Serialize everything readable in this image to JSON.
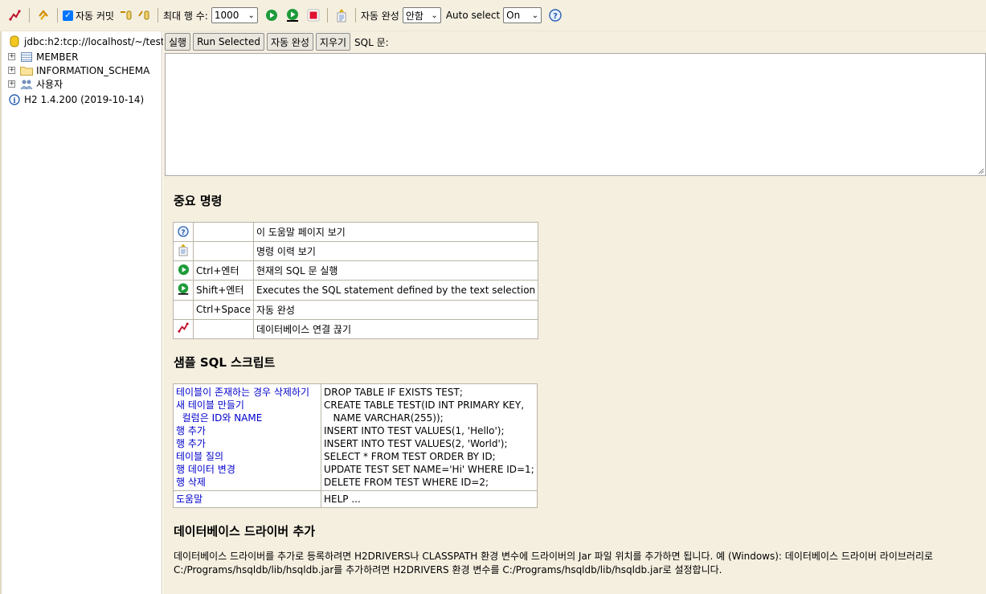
{
  "toolbar": {
    "autocommit_label": "자동 커밋",
    "max_rows_label": "최대 행 수:",
    "max_rows_value": "1000",
    "autocomplete_label": "자동 완성",
    "autocomplete_value": "안함",
    "autoselect_label": "Auto select",
    "autoselect_value": "On"
  },
  "sidebar": {
    "connection": "jdbc:h2:tcp://localhost/~/test",
    "items": [
      {
        "label": "MEMBER",
        "icon": "table-icon"
      },
      {
        "label": "INFORMATION_SCHEMA",
        "icon": "folder-icon"
      },
      {
        "label": "사용자",
        "icon": "users-icon"
      }
    ],
    "version": "H2 1.4.200 (2019-10-14)"
  },
  "query_bar": {
    "run": "실행",
    "run_selected": "Run Selected",
    "autocomplete": "자동 완성",
    "clear": "지우기",
    "sql_label": "SQL 문:"
  },
  "important": {
    "title": "중요 명령",
    "rows": [
      {
        "icon": "help-icon",
        "key": "",
        "desc": "이 도움말 페이지 보기"
      },
      {
        "icon": "history-icon",
        "key": "",
        "desc": "명령 이력 보기"
      },
      {
        "icon": "run-icon",
        "key": "Ctrl+엔터",
        "desc": "현재의 SQL 문 실행"
      },
      {
        "icon": "run-selected-icon",
        "key": "Shift+엔터",
        "desc": "Executes the SQL statement defined by the text selection"
      },
      {
        "icon": "",
        "key": "Ctrl+Space",
        "desc": "자동 완성"
      },
      {
        "icon": "disconnect-icon",
        "key": "",
        "desc": "데이터베이스 연결 끊기"
      }
    ]
  },
  "sample": {
    "title": "샘플 SQL 스크립트",
    "links": [
      "테이블이 존재하는 경우 삭제하기",
      "새 테이블 만들기",
      "  컬럼은 ID와 NAME",
      "행 추가",
      "행 추가",
      "테이블 질의",
      "행 데이터 변경",
      "행 삭제"
    ],
    "code": [
      "DROP TABLE IF EXISTS TEST;",
      "CREATE TABLE TEST(ID INT PRIMARY KEY,",
      "   NAME VARCHAR(255));",
      "INSERT INTO TEST VALUES(1, 'Hello');",
      "INSERT INTO TEST VALUES(2, 'World');",
      "SELECT * FROM TEST ORDER BY ID;",
      "UPDATE TEST SET NAME='Hi' WHERE ID=1;",
      "DELETE FROM TEST WHERE ID=2;"
    ],
    "help_link": "도움말",
    "help_code": "HELP ..."
  },
  "driver": {
    "title": "데이터베이스 드라이버 추가",
    "line1": "데이터베이스 드라이버를 추가로 등록하려면 H2DRIVERS나 CLASSPATH 환경 변수에 드라이버의 Jar 파일 위치를 추가하면 됩니다. 예 (Windows): 데이터베이스 드라이버 라이브러리로",
    "line2": "C:/Programs/hsqldb/lib/hsqldb.jar를 추가하려면 H2DRIVERS 환경 변수를 C:/Programs/hsqldb/lib/hsqldb.jar로 설정합니다."
  },
  "colors": {
    "background": "#f5efe0",
    "link": "#0000cc",
    "run_green": "#1e9b3a",
    "stop_red": "#e0102f"
  }
}
